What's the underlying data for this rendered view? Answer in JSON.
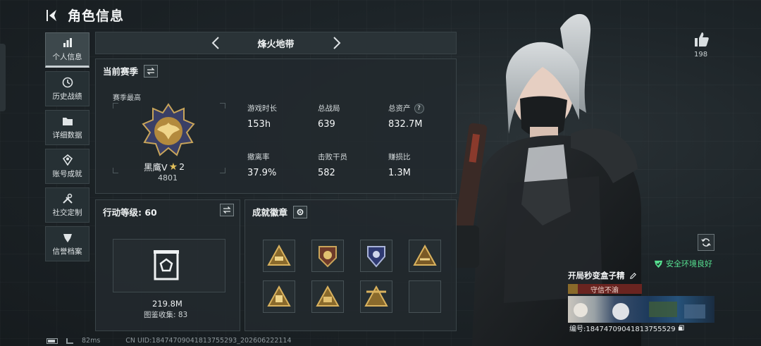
{
  "header": {
    "title": "角色信息"
  },
  "sidebar": {
    "items": [
      {
        "label": "个人信息",
        "icon": "bar-chart-icon",
        "active": true
      },
      {
        "label": "历史战绩",
        "icon": "history-icon"
      },
      {
        "label": "详细数据",
        "icon": "folder-icon"
      },
      {
        "label": "账号成就",
        "icon": "achievement-icon"
      },
      {
        "label": "社交定制",
        "icon": "tools-icon"
      },
      {
        "label": "信誉档案",
        "icon": "shield-icon"
      }
    ]
  },
  "map": {
    "label": "烽火地带"
  },
  "season": {
    "title": "当前赛季",
    "best_label": "赛季最高",
    "rank_name": "黑鹰V",
    "rank_stars": "2",
    "rank_score": "4801",
    "stats": [
      {
        "label": "游戏时长",
        "value": "153h"
      },
      {
        "label": "总战局",
        "value": "639"
      },
      {
        "label": "总资产",
        "value": "832.7M",
        "help": "?"
      },
      {
        "label": "撤离率",
        "value": "37.9%"
      },
      {
        "label": "击败干员",
        "value": "582"
      },
      {
        "label": "赚损比",
        "value": "1.3M"
      }
    ]
  },
  "level": {
    "title": "行动等级: 60",
    "collection_value": "219.8M",
    "collection_count": "图鉴收集: 83"
  },
  "badges": {
    "title": "成就徽章"
  },
  "profile": {
    "likes": "198",
    "safe_env": "安全环境良好",
    "nickname": "开局秒变盒子精",
    "honor": "守信不渝",
    "id_label": "编号:18474709041813755529"
  },
  "footer": {
    "ping": "82ms",
    "uid": "CN UID:18474709041813755293_202606222114"
  },
  "colors": {
    "safe_green": "#56e090",
    "honor_red": "#6a2420",
    "gold": "#e3c05a"
  }
}
